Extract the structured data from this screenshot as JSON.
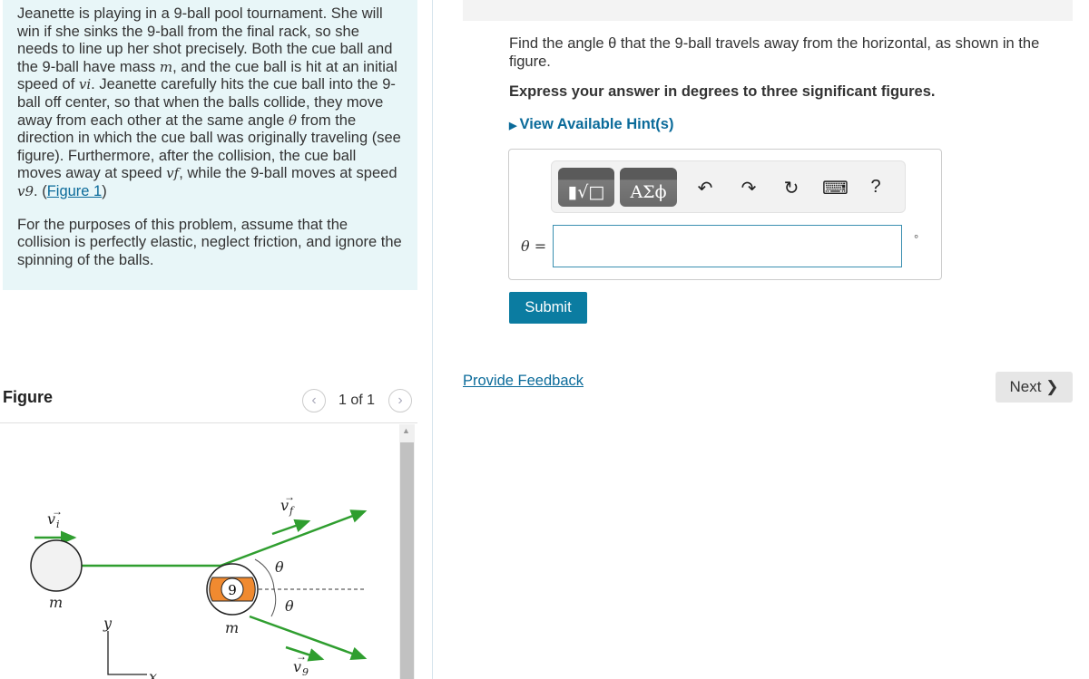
{
  "problem": {
    "paragraph1_parts": [
      "Jeanette is playing in a 9-ball pool tournament. She will win if she sinks the 9-ball from the final rack, so she needs to line up her shot precisely. Both the cue ball and the 9-ball have mass ",
      "m",
      ", and the cue ball is hit at an initial speed of ",
      "vi",
      ". Jeanette carefully hits the cue ball into the 9-ball off center, so that when the balls collide, they move away from each other at the same angle ",
      "θ",
      " from the direction in which the cue ball was originally traveling (see figure). Furthermore, after the collision, the cue ball moves away at speed ",
      "vf",
      ", while the 9-ball moves at speed ",
      "v9",
      ". (",
      "Figure 1",
      ")"
    ],
    "paragraph2": "For the purposes of this problem, assume that the collision is perfectly elastic, neglect friction, and ignore the spinning of the balls."
  },
  "figure": {
    "title": "Figure",
    "pager": "1 of 1",
    "labels": {
      "vi": "v",
      "vi_sub": "i",
      "vf": "v",
      "vf_sub": "f",
      "v9": "v",
      "v9_sub": "9",
      "m": "m",
      "theta": "θ",
      "y": "y",
      "x": "x",
      "ball_number": "9"
    },
    "colors": {
      "arrow": "#2f9e2f",
      "ball9": "#f08a30"
    }
  },
  "question": {
    "prompt": "Find the angle θ that the 9-ball travels away from the horizontal, as shown in the figure.",
    "instruction": "Express your answer in degrees to three significant figures.",
    "hints": "View Available Hint(s)",
    "answer_label": "θ =",
    "answer_value": "",
    "unit": "°",
    "toolbar": {
      "templates": "▮√□",
      "greek": "ΑΣϕ",
      "undo": "↶",
      "redo": "↷",
      "reset": "↻",
      "keyboard": "⌨",
      "help": "?"
    },
    "submit": "Submit"
  },
  "footer": {
    "feedback": "Provide Feedback",
    "next": "Next ❯"
  },
  "colors": {
    "accent": "#0b7ca1",
    "panel": "#e8f6f8"
  }
}
